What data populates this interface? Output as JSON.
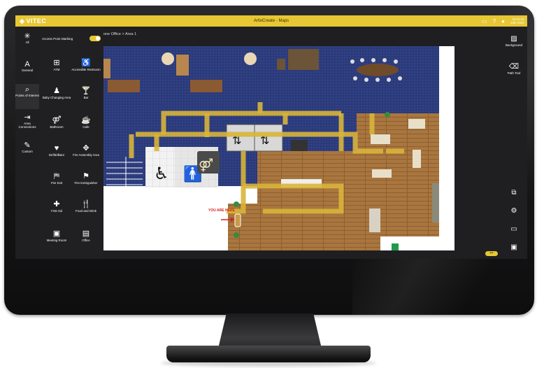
{
  "app": {
    "logo": "VITEC",
    "title": "ArtioCreate - Maps",
    "clock_time": "10:02:21",
    "clock_date": "22th 2021"
  },
  "left_rail": [
    {
      "label": "All",
      "icon": "asterisk-icon",
      "glyph": "✳"
    },
    {
      "label": "General",
      "icon": "letter-a-icon",
      "glyph": "A"
    },
    {
      "label": "Points of Interest",
      "icon": "magnifier-icon",
      "glyph": "⌕"
    },
    {
      "label": "Area Connections",
      "icon": "exit-arrow-icon",
      "glyph": "⇥"
    },
    {
      "label": "Custom",
      "icon": "pencil-icon",
      "glyph": "✎"
    }
  ],
  "panel": {
    "toggle_label": "Access Point Marking",
    "toggle_on": true,
    "items": [
      {
        "label": "ATM",
        "icon": "atm-icon",
        "glyph": "⊞"
      },
      {
        "label": "Accessible Restroom",
        "icon": "wheelchair-icon",
        "glyph": "♿"
      },
      {
        "label": "Baby Changing Area",
        "icon": "baby-changing-icon",
        "glyph": "♟"
      },
      {
        "label": "Bar",
        "icon": "cocktail-icon",
        "glyph": "🍸"
      },
      {
        "label": "Bathroom",
        "icon": "restroom-icon",
        "glyph": "⚤"
      },
      {
        "label": "Cafe",
        "icon": "coffee-cup-icon",
        "glyph": "☕"
      },
      {
        "label": "Defibrillator",
        "icon": "defibrillator-icon",
        "glyph": "♥"
      },
      {
        "label": "Fire Assembly Area",
        "icon": "assembly-area-icon",
        "glyph": "✥"
      },
      {
        "label": "Fire Exit",
        "icon": "fire-exit-icon",
        "glyph": "⛿"
      },
      {
        "label": "Fire Extinguisher",
        "icon": "fire-extinguisher-icon",
        "glyph": "⚑"
      },
      {
        "label": "First Aid",
        "icon": "first-aid-icon",
        "glyph": "✚"
      },
      {
        "label": "Food and Drink",
        "icon": "cutlery-icon",
        "glyph": "🍴"
      },
      {
        "label": "Meeting Room",
        "icon": "meeting-room-icon",
        "glyph": "▣"
      },
      {
        "label": "Office",
        "icon": "office-icon",
        "glyph": "▤"
      }
    ]
  },
  "breadcrumb": {
    "path": "one Office",
    "separator": ">",
    "current": "Area 1"
  },
  "map": {
    "you_are_here": "YOU ARE HERE"
  },
  "right_rail": [
    {
      "label": "Background",
      "icon": "image-icon",
      "glyph": "▨"
    },
    {
      "label": "Path Tool",
      "icon": "eraser-icon",
      "glyph": "⌫"
    },
    {
      "label": "",
      "icon": "layers-icon",
      "glyph": "⧉"
    },
    {
      "label": "",
      "icon": "gear-icon",
      "glyph": "⚙"
    },
    {
      "label": "",
      "icon": "folder-icon",
      "glyph": "▭"
    },
    {
      "label": "",
      "icon": "save-icon",
      "glyph": "▣"
    }
  ],
  "more_label": "•••",
  "colors": {
    "accent": "#e7c734",
    "carpet": "#2a3a78",
    "wood": "#a8743f",
    "path": "#d8b53a"
  }
}
